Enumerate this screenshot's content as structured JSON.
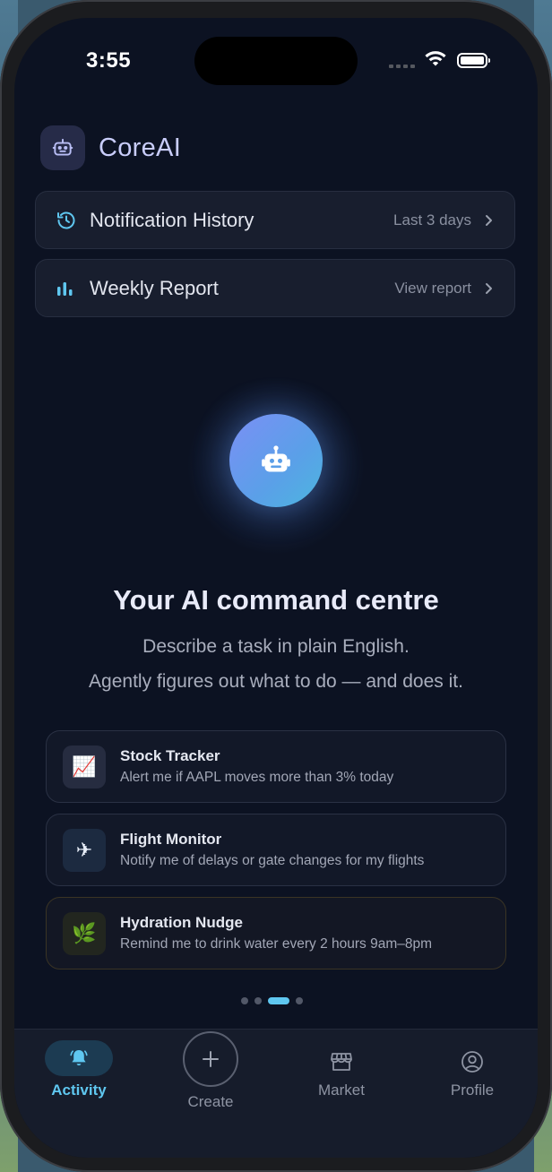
{
  "status": {
    "time": "3:55"
  },
  "app": {
    "name": "CoreAI"
  },
  "links": [
    {
      "title": "Notification History",
      "meta": "Last 3 days",
      "icon": "history-icon"
    },
    {
      "title": "Weekly Report",
      "meta": "View report",
      "icon": "bar-chart-icon"
    }
  ],
  "hero": {
    "title": "Your AI command centre",
    "line1": "Describe a task in plain English.",
    "line2": "Agently figures out what to do — and does it."
  },
  "suggestions": [
    {
      "title": "Stock Tracker",
      "desc": "Alert me if AAPL moves more than 3% today",
      "emoji": "📈",
      "icon": "chart-up-icon"
    },
    {
      "title": "Flight Monitor",
      "desc": "Notify me of delays or gate changes for my flights",
      "emoji": "✈",
      "icon": "airplane-icon"
    },
    {
      "title": "Hydration Nudge",
      "desc": "Remind me to drink water every 2 hours 9am–8pm",
      "emoji": "🌿",
      "icon": "herb-icon"
    }
  ],
  "pager": {
    "count": 4,
    "active_index": 2
  },
  "tabs": [
    {
      "label": "Activity",
      "icon": "bell-icon",
      "active": true
    },
    {
      "label": "Create",
      "icon": "plus-icon",
      "active": false
    },
    {
      "label": "Market",
      "icon": "store-icon",
      "active": false
    },
    {
      "label": "Profile",
      "icon": "user-circle-icon",
      "active": false
    }
  ],
  "colors": {
    "accent": "#5fc7f0",
    "background": "#0c1222",
    "brand_text": "#c9cdfa"
  }
}
